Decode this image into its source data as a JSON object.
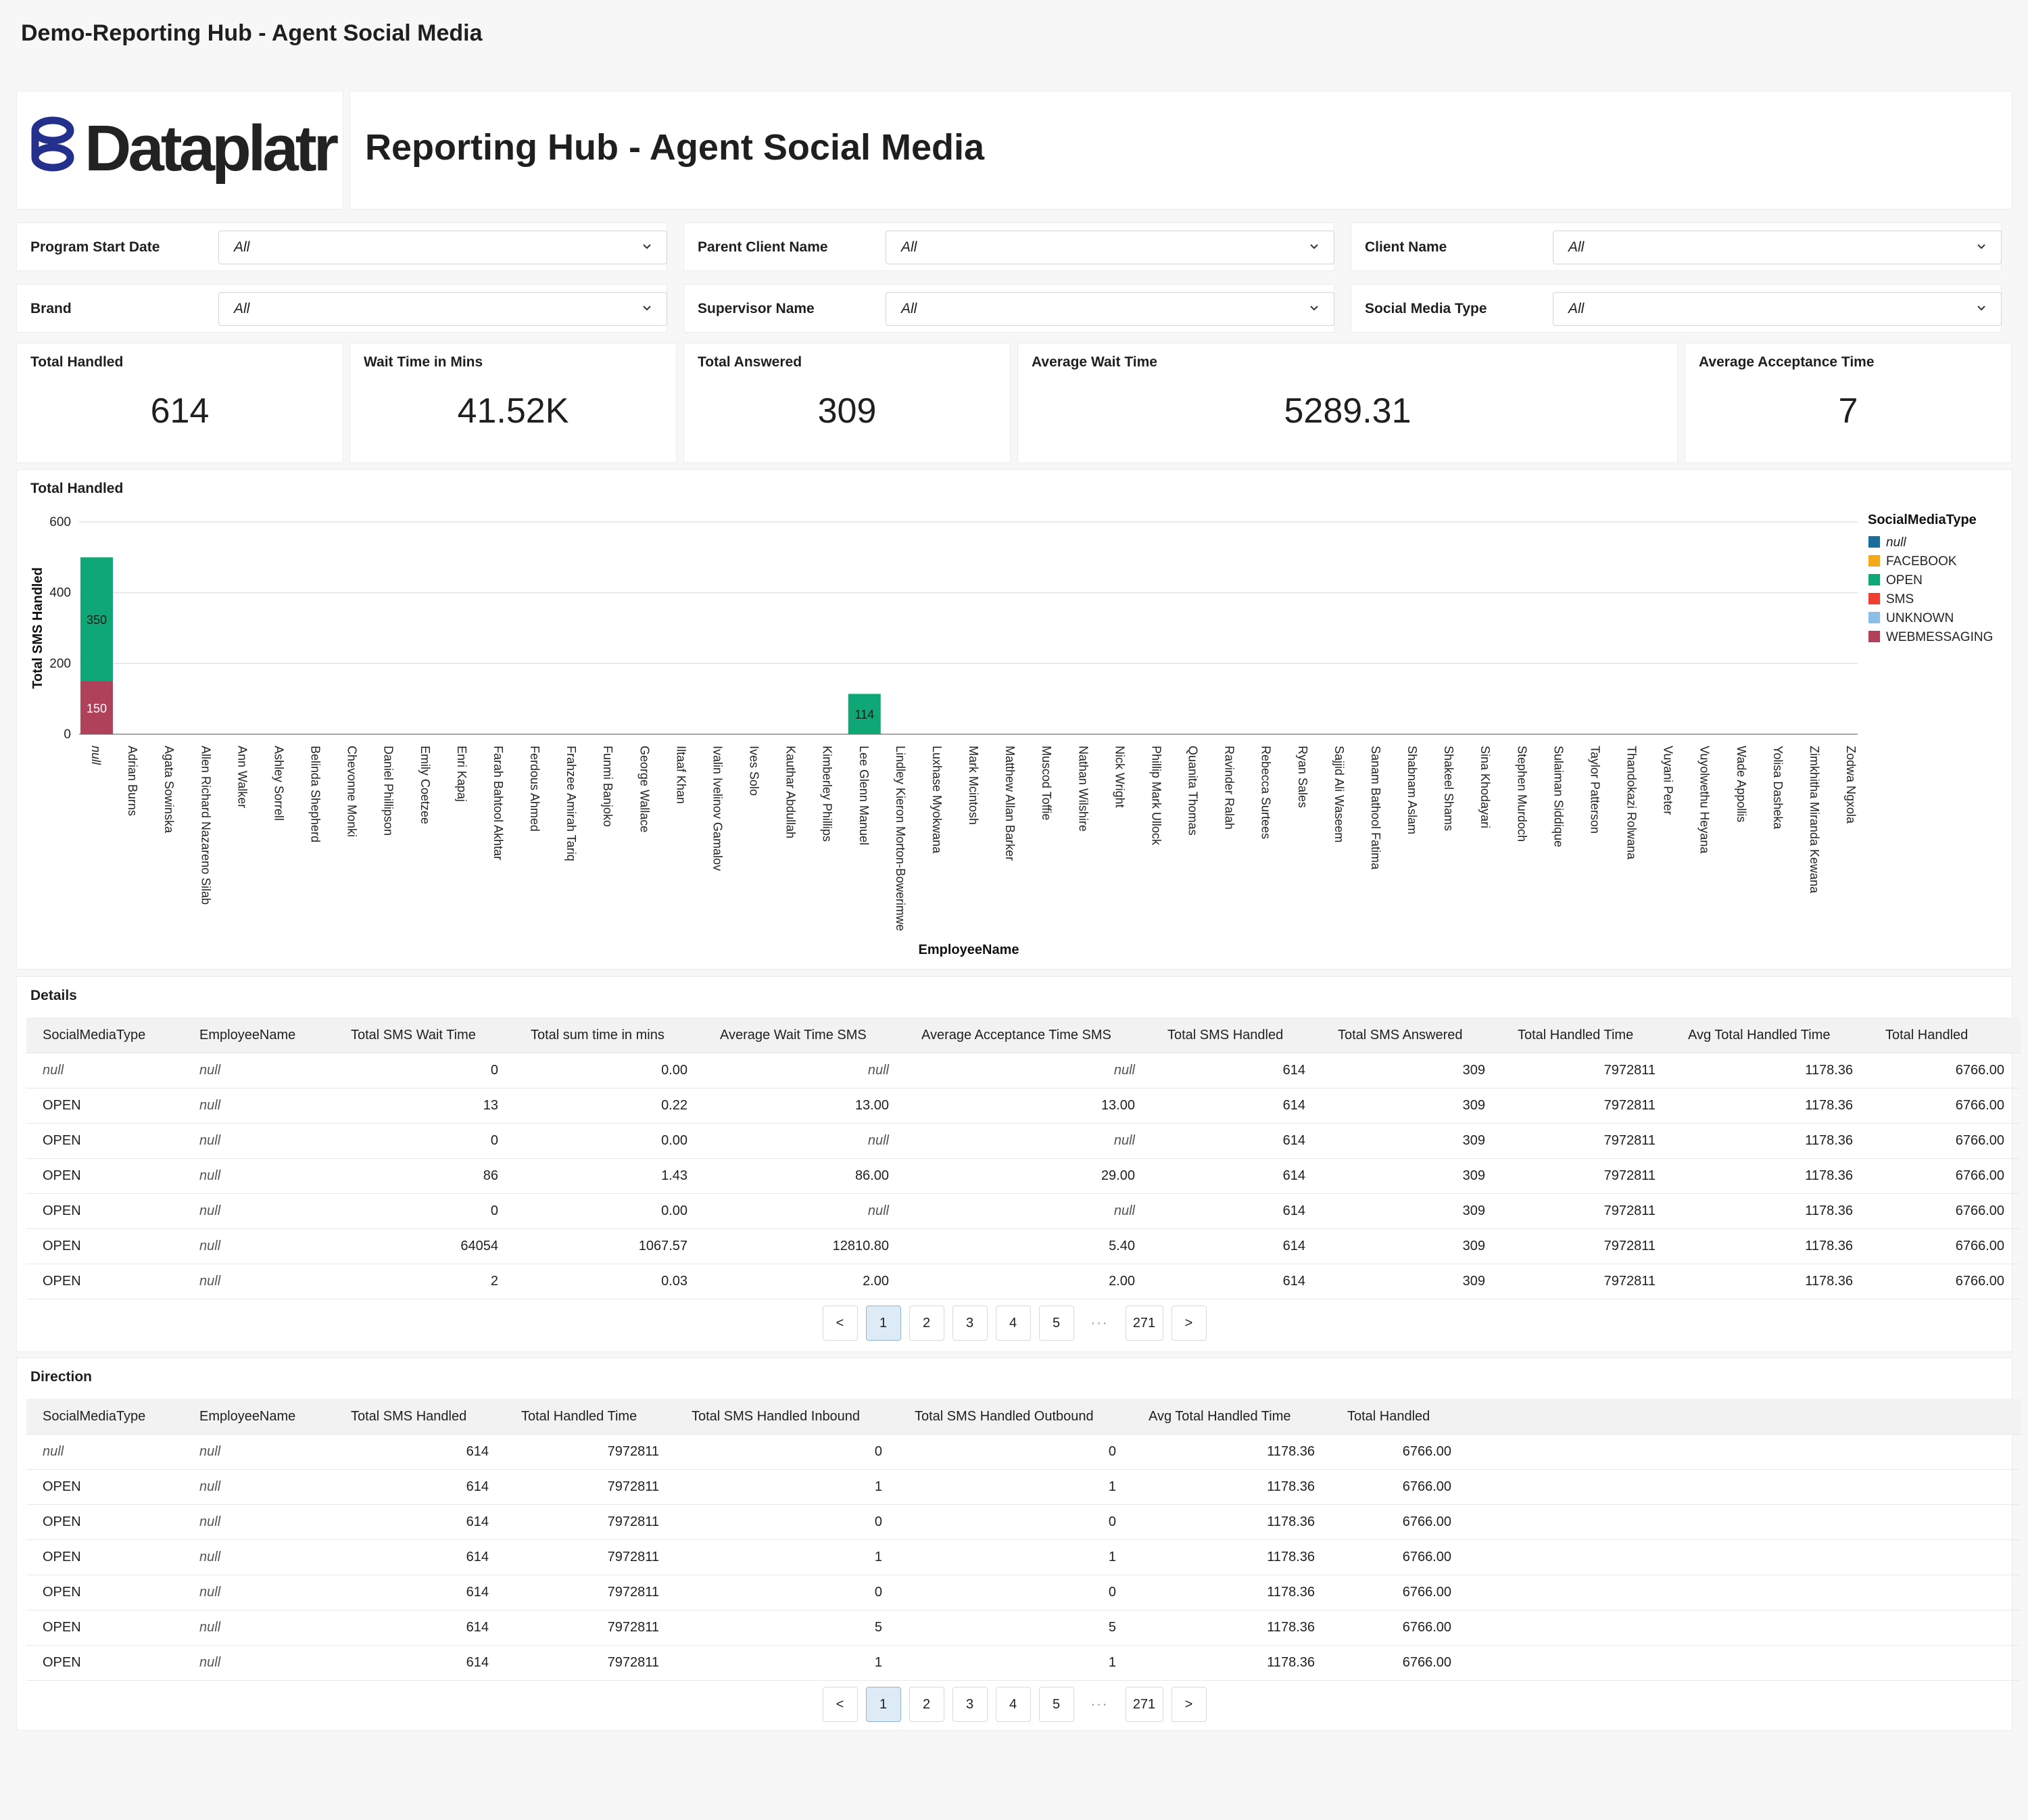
{
  "app_title": "Demo-Reporting Hub - Agent Social Media",
  "logo_text": "Dataplatr",
  "header_title": "Reporting Hub - Agent Social Media",
  "filters": [
    {
      "label": "Program Start Date",
      "value": "All"
    },
    {
      "label": "Parent Client Name",
      "value": "All"
    },
    {
      "label": "Client Name",
      "value": "All"
    },
    {
      "label": "Brand",
      "value": "All"
    },
    {
      "label": "Supervisor Name",
      "value": "All"
    },
    {
      "label": "Social Media Type",
      "value": "All"
    }
  ],
  "kpis": [
    {
      "label": "Total Handled",
      "value": "614"
    },
    {
      "label": "Wait Time in Mins",
      "value": "41.52K"
    },
    {
      "label": "Total Answered",
      "value": "309"
    },
    {
      "label": "Average Wait Time",
      "value": "5289.31"
    },
    {
      "label": "Average Acceptance Time",
      "value": "7"
    }
  ],
  "chart_section_title": "Total Handled",
  "chart_data": {
    "type": "bar",
    "stacked": true,
    "xlabel": "EmployeeName",
    "ylabel": "Total SMS Handled",
    "ylim": [
      0,
      600
    ],
    "yticks": [
      0,
      200,
      400,
      600
    ],
    "grid": true,
    "legend_title": "SocialMediaType",
    "legend_position": "right",
    "categories": [
      "null",
      "Adrian Burns",
      "Agata Sowinska",
      "Allen Richard Nazareno Silab",
      "Ann Walker",
      "Ashley Sorrell",
      "Belinda Shepherd",
      "Chevonne Monki",
      "Daniel Phillipson",
      "Emily Coetzee",
      "Enri Kapaj",
      "Farah Bahtool Akhtar",
      "Ferdous Ahmed",
      "Frahzee Amirah Tariq",
      "Funmi Banjoko",
      "George Wallace",
      "Iltaaf Khan",
      "Ivalin Ivelinov Gamalov",
      "Ives Solo",
      "Kauthar Abdullah",
      "Kimberley Phillips",
      "Lee Glenn Manuel",
      "Lindley Kieron Morton-Bowerimwe",
      "Luxhase Myokwana",
      "Mark Mcintosh",
      "Matthew Allan Barker",
      "Muscod Toffie",
      "Nathan Wilshire",
      "Nick Wright",
      "Phillip Mark Ullock",
      "Quanita Thomas",
      "Ravinder Ralah",
      "Rebecca Surtees",
      "Ryan Sales",
      "Sajjid Ali Waseem",
      "Sanam Bathool Fatima",
      "Shabnam Aslam",
      "Shakeel Shams",
      "Sina Khodayari",
      "Stephen Murdoch",
      "Sulaiman Siddique",
      "Taylor Patterson",
      "Thandokazi Rolwana",
      "Vuyani Peter",
      "Vuyolwethu Heyana",
      "Wade Appollis",
      "Yolisa Dasheka",
      "Zimkhitha Miranda Kewana",
      "Zodwa Ngxola"
    ],
    "series": [
      {
        "name": "null",
        "color": "#1a6e9b",
        "values": []
      },
      {
        "name": "FACEBOOK",
        "color": "#f2a91e",
        "values": []
      },
      {
        "name": "OPEN",
        "color": "#0fa775",
        "values": [
          350,
          0,
          0,
          0,
          0,
          0,
          0,
          0,
          0,
          0,
          0,
          0,
          0,
          0,
          0,
          0,
          0,
          0,
          0,
          0,
          0,
          114,
          0,
          0,
          0,
          0,
          0,
          0,
          0,
          0,
          0,
          0,
          0,
          0,
          0,
          0,
          0,
          0,
          0,
          0,
          0,
          0,
          0,
          0,
          0,
          0,
          0,
          0,
          0
        ]
      },
      {
        "name": "SMS",
        "color": "#ee3f31",
        "values": []
      },
      {
        "name": "UNKNOWN",
        "color": "#8bbfe8",
        "values": []
      },
      {
        "name": "WEBMESSAGING",
        "color": "#b0415a",
        "values": [
          150,
          0,
          0,
          0,
          0,
          0,
          0,
          0,
          0,
          0,
          0,
          0,
          0,
          0,
          0,
          0,
          0,
          0,
          0,
          0,
          0,
          0,
          0,
          0,
          0,
          0,
          0,
          0,
          0,
          0,
          0,
          0,
          0,
          0,
          0,
          0,
          0,
          0,
          0,
          0,
          0,
          0,
          0,
          0,
          0,
          0,
          0,
          0,
          0
        ]
      }
    ],
    "data_labels": [
      {
        "category": "null",
        "series": "OPEN",
        "text": "350"
      },
      {
        "category": "null",
        "series": "WEBMESSAGING",
        "text": "150"
      },
      {
        "category": "Lee Glenn Manuel",
        "series": "OPEN",
        "text": "114"
      }
    ]
  },
  "details": {
    "title": "Details",
    "columns": [
      "SocialMediaType",
      "EmployeeName",
      "Total SMS Wait Time",
      "Total sum time in mins",
      "Average Wait Time SMS",
      "Average Acceptance Time SMS",
      "Total SMS Handled",
      "Total SMS Answered",
      "Total Handled Time",
      "Avg Total Handled Time",
      "Total Handled"
    ],
    "rows": [
      [
        "null",
        "null",
        "0",
        "0.00",
        "null",
        "null",
        "614",
        "309",
        "7972811",
        "1178.36",
        "6766.00"
      ],
      [
        "OPEN",
        "null",
        "13",
        "0.22",
        "13.00",
        "13.00",
        "614",
        "309",
        "7972811",
        "1178.36",
        "6766.00"
      ],
      [
        "OPEN",
        "null",
        "0",
        "0.00",
        "null",
        "null",
        "614",
        "309",
        "7972811",
        "1178.36",
        "6766.00"
      ],
      [
        "OPEN",
        "null",
        "86",
        "1.43",
        "86.00",
        "29.00",
        "614",
        "309",
        "7972811",
        "1178.36",
        "6766.00"
      ],
      [
        "OPEN",
        "null",
        "0",
        "0.00",
        "null",
        "null",
        "614",
        "309",
        "7972811",
        "1178.36",
        "6766.00"
      ],
      [
        "OPEN",
        "null",
        "64054",
        "1067.57",
        "12810.80",
        "5.40",
        "614",
        "309",
        "7972811",
        "1178.36",
        "6766.00"
      ],
      [
        "OPEN",
        "null",
        "2",
        "0.03",
        "2.00",
        "2.00",
        "614",
        "309",
        "7972811",
        "1178.36",
        "6766.00"
      ]
    ]
  },
  "direction": {
    "title": "Direction",
    "columns": [
      "SocialMediaType",
      "EmployeeName",
      "Total SMS Handled",
      "Total Handled Time",
      "Total SMS Handled Inbound",
      "Total SMS Handled Outbound",
      "Avg Total Handled Time",
      "Total Handled"
    ],
    "rows": [
      [
        "null",
        "null",
        "614",
        "7972811",
        "0",
        "0",
        "1178.36",
        "6766.00"
      ],
      [
        "OPEN",
        "null",
        "614",
        "7972811",
        "1",
        "1",
        "1178.36",
        "6766.00"
      ],
      [
        "OPEN",
        "null",
        "614",
        "7972811",
        "0",
        "0",
        "1178.36",
        "6766.00"
      ],
      [
        "OPEN",
        "null",
        "614",
        "7972811",
        "1",
        "1",
        "1178.36",
        "6766.00"
      ],
      [
        "OPEN",
        "null",
        "614",
        "7972811",
        "0",
        "0",
        "1178.36",
        "6766.00"
      ],
      [
        "OPEN",
        "null",
        "614",
        "7972811",
        "5",
        "5",
        "1178.36",
        "6766.00"
      ],
      [
        "OPEN",
        "null",
        "614",
        "7972811",
        "1",
        "1",
        "1178.36",
        "6766.00"
      ]
    ]
  },
  "pagination": {
    "prev": "<",
    "next": ">",
    "pages": [
      "1",
      "2",
      "3",
      "4",
      "5"
    ],
    "ellipsis": "···",
    "last": "271",
    "current": "1"
  }
}
